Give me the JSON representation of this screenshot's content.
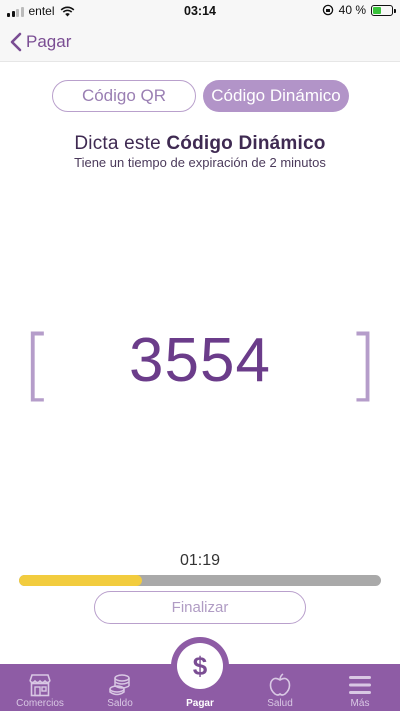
{
  "status_bar": {
    "carrier": "entel",
    "time": "03:14",
    "battery": "40 %"
  },
  "nav": {
    "back_label": "Pagar"
  },
  "segments": {
    "qr_label": "Código QR",
    "dynamic_label": "Código Dinámico",
    "selected": "dynamic"
  },
  "instructions": {
    "prefix": "Dicta este ",
    "emphasis": "Código Dinámico",
    "subtitle": "Tiene un tiempo de expiración de 2 minutos"
  },
  "code": {
    "value": "3554",
    "bracket_left": "[",
    "bracket_right": "]"
  },
  "timer": {
    "remaining": "01:19",
    "progress_fraction": 0.34
  },
  "finish_label": "Finalizar",
  "tabs": [
    {
      "label": "Comercios",
      "icon": "store-icon"
    },
    {
      "label": "Saldo",
      "icon": "coins-icon"
    },
    {
      "label": "Pagar",
      "icon": "dollar-icon",
      "active": true
    },
    {
      "label": "Salud",
      "icon": "apple-icon"
    },
    {
      "label": "Más",
      "icon": "menu-icon"
    }
  ],
  "pay_symbol": "$",
  "colors": {
    "brand": "#8e5ca5",
    "code": "#6b3c8a",
    "progress": "#f2cc3e"
  }
}
